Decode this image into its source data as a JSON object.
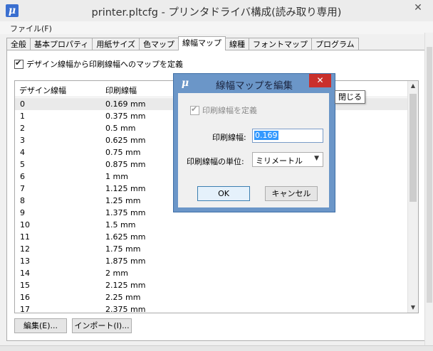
{
  "window": {
    "title": "printer.pltcfg - プリンタドライバ構成(読み取り専用)",
    "close_glyph": "✕"
  },
  "menubar": {
    "file": "ファイル(F)"
  },
  "tabs": [
    {
      "label": "全般"
    },
    {
      "label": "基本プロパティ"
    },
    {
      "label": "用紙サイズ"
    },
    {
      "label": "色マップ"
    },
    {
      "label": "線幅マップ",
      "active": true
    },
    {
      "label": "線種"
    },
    {
      "label": "フォントマップ"
    },
    {
      "label": "プログラム"
    }
  ],
  "panel": {
    "map_checkbox_label": "デザイン線幅から印刷線幅へのマップを定義",
    "list": {
      "col_design": "デザイン線幅",
      "col_print": "印刷線幅",
      "rows": [
        {
          "design": "0",
          "print": "0.169 mm"
        },
        {
          "design": "1",
          "print": "0.375 mm"
        },
        {
          "design": "2",
          "print": "0.5 mm"
        },
        {
          "design": "3",
          "print": "0.625 mm"
        },
        {
          "design": "4",
          "print": "0.75 mm"
        },
        {
          "design": "5",
          "print": "0.875 mm"
        },
        {
          "design": "6",
          "print": "1 mm"
        },
        {
          "design": "7",
          "print": "1.125 mm"
        },
        {
          "design": "8",
          "print": "1.25 mm"
        },
        {
          "design": "9",
          "print": "1.375 mm"
        },
        {
          "design": "10",
          "print": "1.5 mm"
        },
        {
          "design": "11",
          "print": "1.625 mm"
        },
        {
          "design": "12",
          "print": "1.75 mm"
        },
        {
          "design": "13",
          "print": "1.875 mm"
        },
        {
          "design": "14",
          "print": "2 mm"
        },
        {
          "design": "15",
          "print": "2.125 mm"
        },
        {
          "design": "16",
          "print": "2.25 mm"
        },
        {
          "design": "17",
          "print": "2.375 mm"
        }
      ]
    },
    "edit_button": "編集(E)...",
    "import_button": "インポート(I)..."
  },
  "dialog": {
    "title": "線幅マップを編集",
    "close_glyph": "✕",
    "define_checkbox_label": "印刷線幅を定義",
    "print_width_label": "印刷線幅:",
    "print_width_value": "0.169",
    "unit_label": "印刷線幅の単位:",
    "unit_value": "ミリメートル",
    "ok": "OK",
    "cancel": "キャンセル"
  },
  "tooltip": "閉じる",
  "colors": {
    "dialog_frame": "#6b96c8",
    "close_red": "#c9302c",
    "selection": "#3399ff"
  }
}
